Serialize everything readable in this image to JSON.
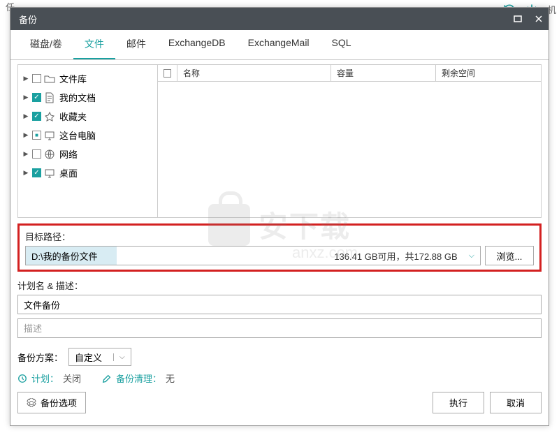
{
  "bg_partial_text": "任",
  "bg_right_text": "机",
  "dialog": {
    "title": "备份"
  },
  "tabs": [
    {
      "label": "磁盘/卷"
    },
    {
      "label": "文件"
    },
    {
      "label": "邮件"
    },
    {
      "label": "ExchangeDB"
    },
    {
      "label": "ExchangeMail"
    },
    {
      "label": "SQL"
    }
  ],
  "tree": [
    {
      "label": "文件库",
      "state": "unchecked",
      "icon": "folder"
    },
    {
      "label": "我的文档",
      "state": "checked",
      "icon": "document"
    },
    {
      "label": "收藏夹",
      "state": "checked",
      "icon": "star"
    },
    {
      "label": "这台电脑",
      "state": "partial",
      "icon": "monitor"
    },
    {
      "label": "网络",
      "state": "unchecked",
      "icon": "globe"
    },
    {
      "label": "桌面",
      "state": "checked",
      "icon": "monitor"
    }
  ],
  "list_headers": [
    "名称",
    "容量",
    "剩余空间"
  ],
  "target": {
    "label": "目标路径：",
    "path": "D:\\我的备份文件",
    "space_info": "136.41 GB可用，共172.88 GB",
    "browse": "浏览..."
  },
  "plan": {
    "label": "计划名 & 描述：",
    "name_value": "文件备份",
    "desc_placeholder": "描述"
  },
  "scheme": {
    "label": "备份方案：",
    "value": "自定义"
  },
  "status": {
    "plan_label": "计划：",
    "plan_value": "关闭",
    "clean_label": "备份清理：",
    "clean_value": "无"
  },
  "footer": {
    "options": "备份选项",
    "execute": "执行",
    "cancel": "取消"
  },
  "watermark": {
    "main": "安下载",
    "sub": "anxz.com"
  }
}
